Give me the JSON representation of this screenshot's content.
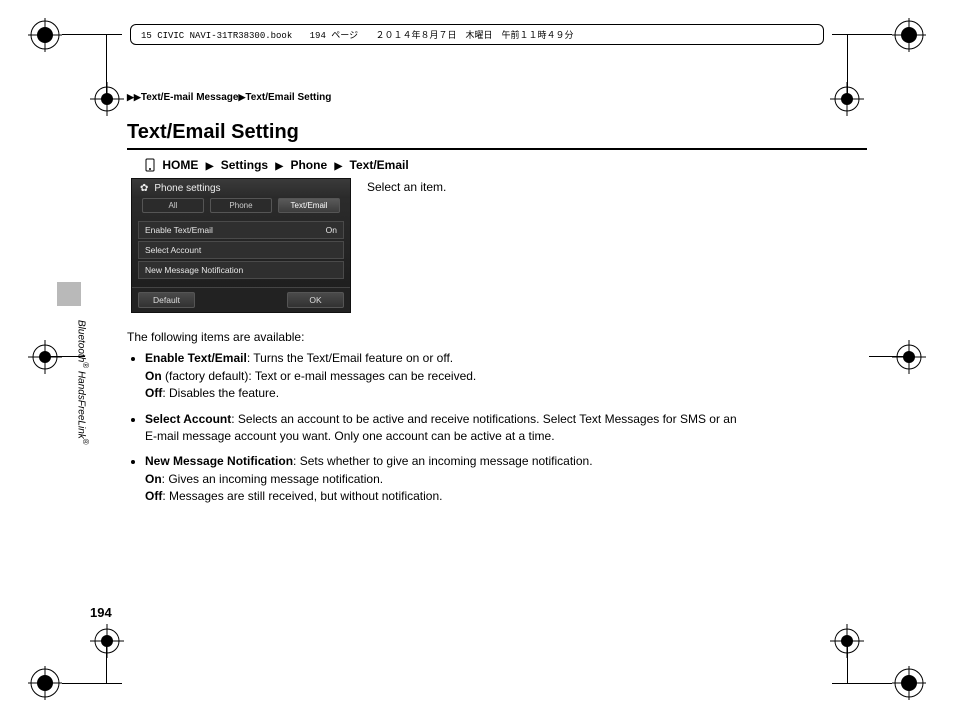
{
  "framemaker": {
    "file": "15 CIVIC NAVI-31TR38300.book",
    "page": "194 ページ",
    "date": "２０１４年８月７日　木曜日　午前１１時４９分"
  },
  "breadcrumb_top": {
    "seg1": "Text/E-mail Message",
    "seg2": "Text/Email Setting"
  },
  "title": "Text/Email Setting",
  "nav": {
    "home": "HOME",
    "s1": "Settings",
    "s2": "Phone",
    "s3": "Text/Email"
  },
  "device": {
    "title": "Phone settings",
    "tabs": {
      "all": "All",
      "phone": "Phone",
      "text": "Text/Email"
    },
    "items": {
      "enable": {
        "label": "Enable Text/Email",
        "value": "On"
      },
      "select": {
        "label": "Select Account"
      },
      "notify": {
        "label": "New Message Notification"
      }
    },
    "buttons": {
      "default": "Default",
      "ok": "OK"
    }
  },
  "prompt": "Select an item.",
  "body": {
    "intro": "The following items are available:",
    "b1": {
      "head": "Enable Text/Email",
      "tail": ": Turns the Text/Email feature on or off.",
      "on_head": "On",
      "on_tail": " (factory default): Text or e-mail messages can be received.",
      "off_head": "Off",
      "off_tail": ": Disables the feature."
    },
    "b2": {
      "head": "Select Account",
      "tail": ": Selects an account to be active and receive notifications. Select Text Messages for SMS or an E-mail message account you want. Only one account can be active at a time."
    },
    "b3": {
      "head": "New Message Notification",
      "tail": ": Sets whether to give an incoming message notification.",
      "on_head": "On",
      "on_tail": ": Gives an incoming message notification.",
      "off_head": "Off",
      "off_tail": ": Messages are still received, but without notification."
    }
  },
  "side_label": {
    "p1": "Bluetooth",
    "p2": " HandsFreeLink"
  },
  "page_number": "194"
}
